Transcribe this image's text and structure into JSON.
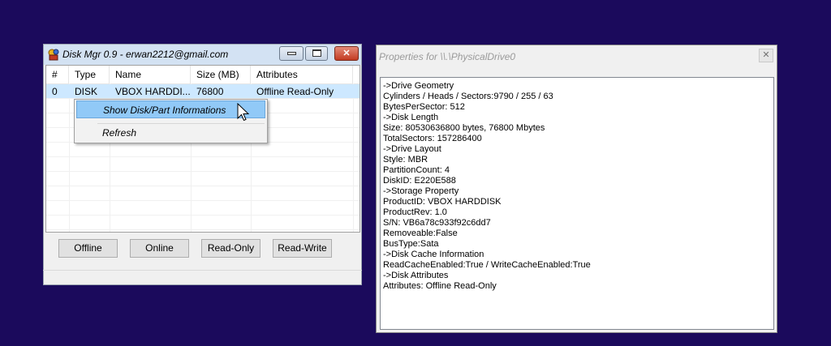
{
  "disk_manager": {
    "title": "Disk Mgr 0.9 - erwan2212@gmail.com",
    "columns": [
      "#",
      "Type",
      "Name",
      "Size (MB)",
      "Attributes"
    ],
    "rows": [
      {
        "index": "0",
        "type": "DISK",
        "name": "VBOX HARDDI...",
        "size": "76800",
        "attributes": "Offline Read-Only"
      }
    ],
    "context_menu": {
      "items": [
        "Show Disk/Part Informations",
        "Refresh"
      ]
    },
    "buttons": {
      "offline": "Offline",
      "online": "Online",
      "read_only": "Read-Only",
      "read_write": "Read-Write"
    },
    "close_glyph": "✕"
  },
  "properties": {
    "title": "Properties for \\\\.\\PhysicalDrive0",
    "close_glyph": "✕",
    "lines": [
      "->Drive Geometry",
      "Cylinders / Heads / Sectors:9790 / 255 / 63",
      "BytesPerSector: 512",
      "->Disk Length",
      "Size: 80530636800 bytes, 76800 Mbytes",
      "TotalSectors: 157286400",
      "->Drive Layout",
      "Style: MBR",
      "PartitionCount: 4",
      "DiskID: E220E588",
      "->Storage Property",
      "ProductID: VBOX HARDDISK",
      "ProductRev: 1.0",
      "S/N: VB6a78c933f92c6dd7",
      "Removeable:False",
      "BusType:Sata",
      "->Disk Cache Information",
      "ReadCacheEnabled:True / WriteCacheEnabled:True",
      "->Disk Attributes",
      "Attributes: Offline Read-Only"
    ]
  },
  "colors": {
    "desktop": "#1b0a5c",
    "selection": "#cde8ff",
    "menu_highlight": "#91c9f7"
  }
}
